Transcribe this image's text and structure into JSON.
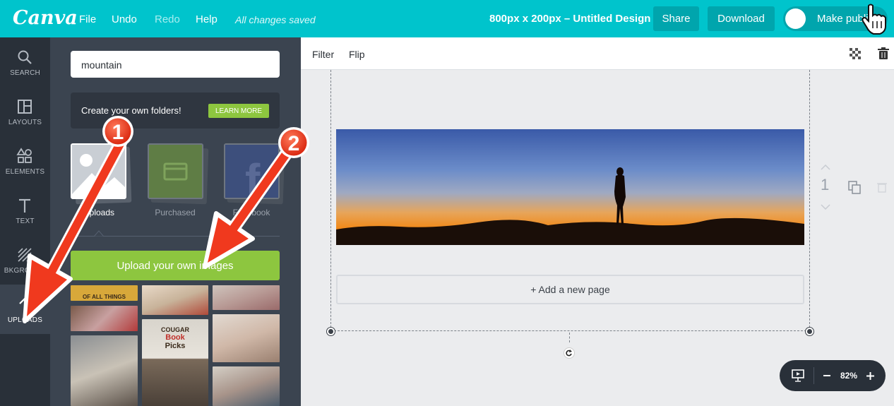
{
  "header": {
    "logo": "Canva",
    "menu": [
      "File",
      "Undo",
      "Redo",
      "Help"
    ],
    "status": "All changes saved",
    "design_title": "800px x 200px – Untitled Design",
    "share": "Share",
    "download": "Download",
    "make_public": "Make public"
  },
  "rail": {
    "items": [
      {
        "label": "SEARCH",
        "icon": "search-icon"
      },
      {
        "label": "LAYOUTS",
        "icon": "layouts-icon"
      },
      {
        "label": "ELEMENTS",
        "icon": "elements-icon"
      },
      {
        "label": "TEXT",
        "icon": "text-icon"
      },
      {
        "label": "BKGROUND",
        "icon": "background-icon"
      },
      {
        "label": "UPLOADS",
        "icon": "upload-arrow-icon"
      }
    ],
    "active": "UPLOADS"
  },
  "panel": {
    "search_value": "mountain",
    "folders_text": "Create your own folders!",
    "learn_more": "LEARN MORE",
    "tabs": [
      "Uploads",
      "Purchased",
      "Facebook"
    ],
    "active_tab": "Uploads",
    "upload_button": "Upload your own images",
    "thumb_texts": {
      "banner": "OF ALL THINGS",
      "sign_line1": "COUGAR",
      "sign_line2": "Book",
      "sign_line3": "Picks"
    }
  },
  "canvas": {
    "toolbar": [
      "Filter",
      "Flip"
    ],
    "add_page": "+ Add a new page",
    "page_number": "1",
    "zoom": "82%"
  },
  "annotations": {
    "badge1": "1",
    "badge2": "2"
  },
  "colors": {
    "brand": "#00c4cc",
    "green": "#8dc63f",
    "arrow": "#f0391e"
  }
}
